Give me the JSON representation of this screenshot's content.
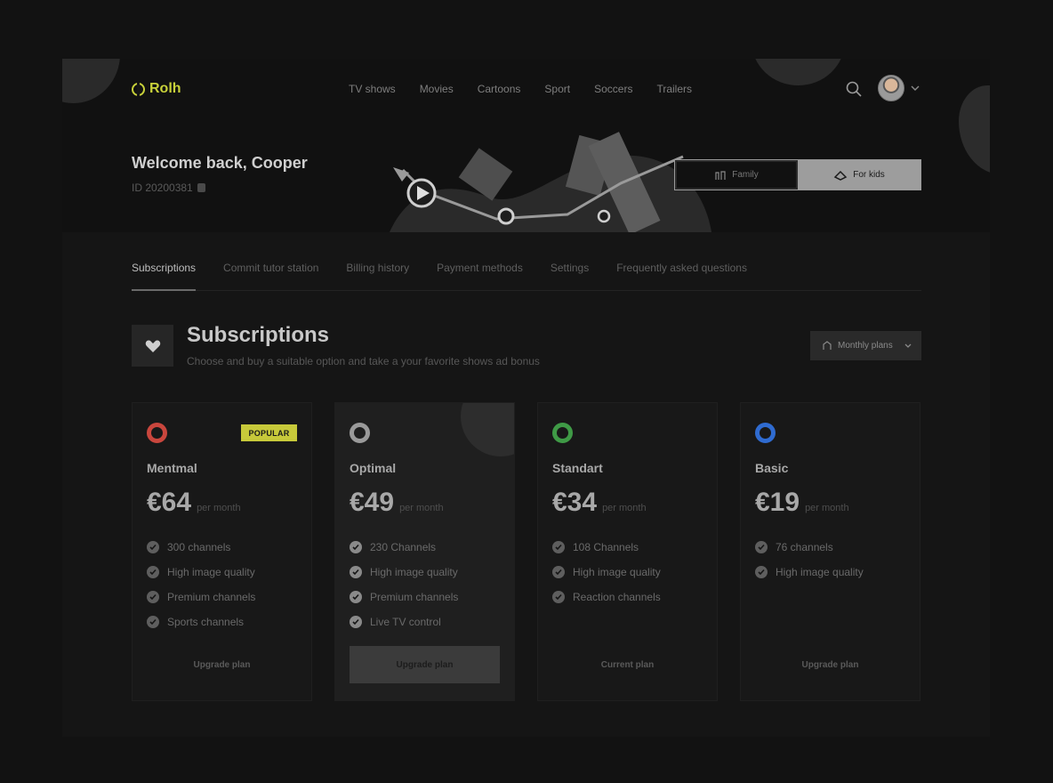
{
  "app": {
    "logo_text": "Rolh"
  },
  "nav": {
    "items": [
      "TV shows",
      "Movies",
      "Cartoons",
      "Sport",
      "Soccers",
      "Trailers"
    ]
  },
  "hero": {
    "welcome": "Welcome back, Cooper",
    "user_id": "ID 20200381",
    "toggle": {
      "option_a": "Family",
      "option_b": "For kids"
    }
  },
  "tabs": [
    "Subscriptions",
    "Commit tutor station",
    "Billing history",
    "Payment methods",
    "Settings",
    "Frequently asked questions"
  ],
  "section": {
    "title": "Subscriptions",
    "subtitle": "Choose and buy a suitable option and take a your favorite shows ad bonus",
    "dropdown_label": "Monthly plans"
  },
  "plans": [
    {
      "name": "Mentmal",
      "price": "€64",
      "period": "per month",
      "badge": "POPULAR",
      "ring_color": "#c9463d",
      "features": [
        "300 channels",
        "High image quality",
        "Premium channels",
        "Sports channels"
      ],
      "button": "Upgrade plan"
    },
    {
      "name": "Optimal",
      "price": "€49",
      "period": "per month",
      "ring_color": "#9a9a9a",
      "features": [
        "230 Channels",
        "High image quality",
        "Premium channels",
        "Live TV control"
      ],
      "button": "Upgrade plan"
    },
    {
      "name": "Standart",
      "price": "€34",
      "period": "per month",
      "ring_color": "#3f9a46",
      "features": [
        "108 Channels",
        "High image quality",
        "Reaction channels"
      ],
      "button": "Current plan"
    },
    {
      "name": "Basic",
      "price": "€19",
      "period": "per month",
      "ring_color": "#2f6bd0",
      "features": [
        "76 channels",
        "High image quality"
      ],
      "button": "Upgrade plan"
    }
  ]
}
